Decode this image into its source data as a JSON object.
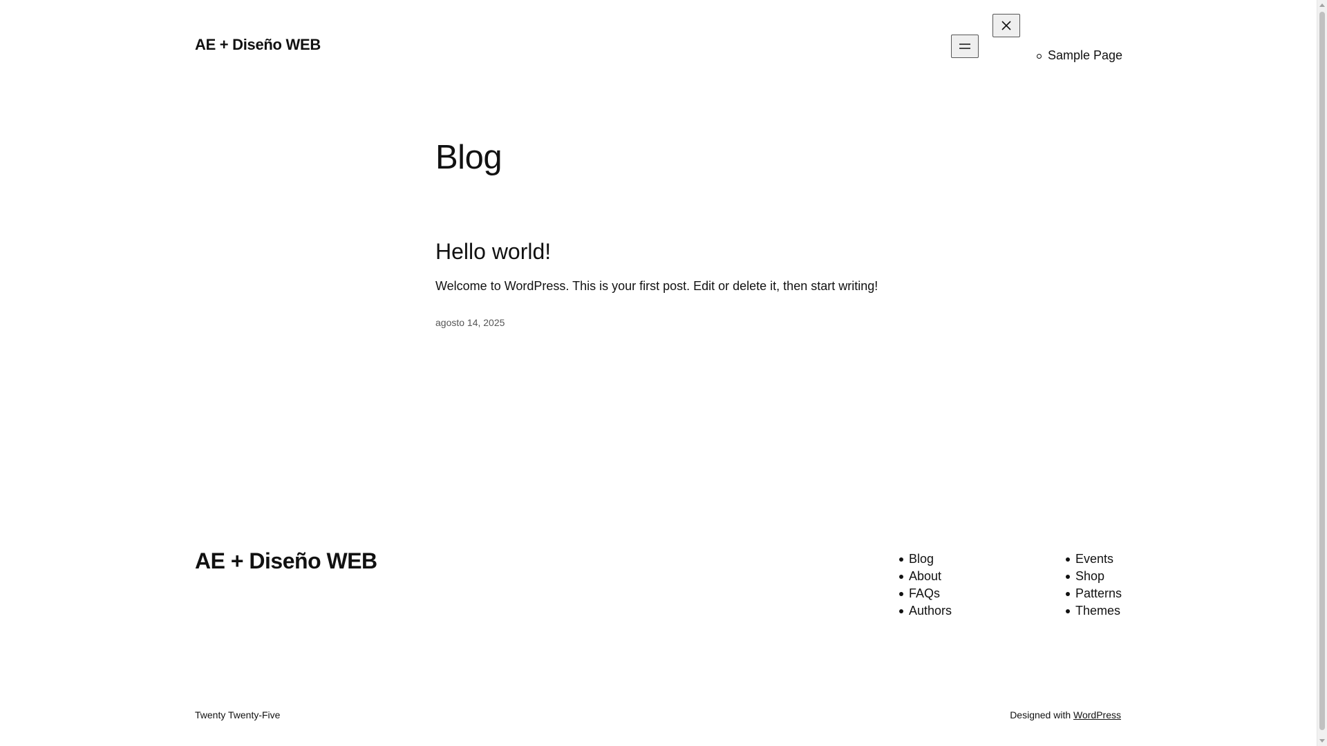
{
  "header": {
    "site_title": "AE + Diseño WEB",
    "open_menu_icon": "hamburger-icon",
    "close_menu_icon": "close-icon",
    "overlay_menu": [
      {
        "label": "Sample Page"
      }
    ]
  },
  "main": {
    "page_heading": "Blog",
    "posts": [
      {
        "title": "Hello world!",
        "excerpt": "Welcome to WordPress. This is your first post. Edit or delete it, then start writing!",
        "date": "agosto 14, 2025"
      }
    ]
  },
  "footer": {
    "site_title": "AE + Diseño WEB",
    "nav_col_1": [
      "Blog",
      "About",
      "FAQs",
      "Authors"
    ],
    "nav_col_2": [
      "Events",
      "Shop",
      "Patterns",
      "Themes"
    ],
    "credit_left": "Twenty Twenty-Five",
    "credit_right_prefix": "Designed with ",
    "credit_right_link": "WordPress"
  }
}
